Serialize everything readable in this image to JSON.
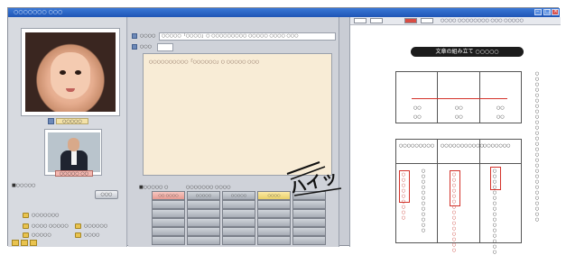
{
  "window": {
    "title": "○○○○○○○ ○○○",
    "right_title": "○○○○ ○○○○○○○○ ○○○ ○○○○○"
  },
  "left": {
    "student_name": "○○○○○",
    "teacher_name": "○○○○○ ○○",
    "section_label": "■○○○○○",
    "apply_button": "○○○",
    "options": [
      "○○○○○○○",
      "○○○○ ○○○○○",
      "○○○○○○",
      "○○○○○",
      "○○○○"
    ]
  },
  "center": {
    "field1_label": "○○○○",
    "field1_value": "○○○○○「○○○○」○ ○○○○○○○○○ ○○○○○ ○○○○ ○○○",
    "field2_label": "○○○",
    "notes_text": "○○○○○○○○○○「○○○○○○」○ ○○○○○ ○○○",
    "grid_label": "■○○○○○ ○",
    "grid_header_extra": "○○○○○○○ ○○○○",
    "grid_cells": [
      [
        "○○ ○○○○",
        "○○○○○",
        "○○○○○",
        "○○○○",
        ""
      ],
      [
        "",
        "",
        "",
        "",
        ""
      ],
      [
        "",
        "",
        "",
        "",
        ""
      ],
      [
        "",
        "",
        "",
        "",
        ""
      ],
      [
        "",
        "",
        "",
        "",
        ""
      ],
      [
        "",
        "",
        "",
        "",
        ""
      ]
    ],
    "response_text": "ハイッ"
  },
  "doc": {
    "title": "文章の組み立て ○○○○○",
    "heading_left": "○○",
    "heading_mid": "○○",
    "heading_right": "○○",
    "sub1": "○○",
    "sub2": "○○",
    "sub3": "○○",
    "row_left": "○○○○○○○○○",
    "row_mid": "○○○○○○○○○○○",
    "row_right": "○○○○○○○",
    "v1": "○○○○○○○○○",
    "v2": "○○○○○○○○○○○○",
    "v3": "○○○○○○○○○○○○○○○",
    "v4": "○○○○○○○○○○○○○○○○",
    "side_text": "○○○○○○○○○○○○○○○○○○○○○○○○○○○○"
  },
  "colors": {
    "title_bar": "#1f55b5",
    "notes_bg": "#f8ecd6",
    "accent_red": "#d3322a",
    "highlight_pink": "#e69b92",
    "highlight_yellow": "#e8cf68"
  }
}
